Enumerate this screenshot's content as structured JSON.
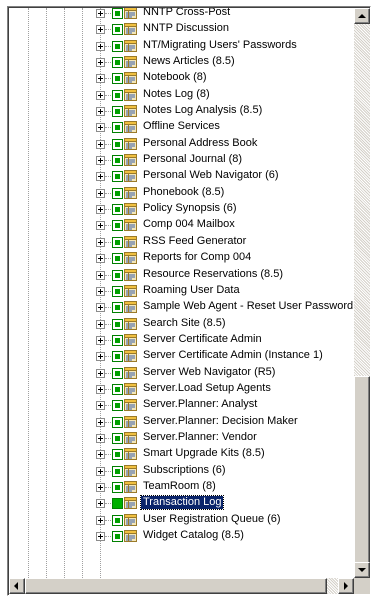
{
  "tree": {
    "selected_index": 28,
    "items": [
      {
        "label": "NNTP Cross-Post"
      },
      {
        "label": "NNTP Discussion"
      },
      {
        "label": "NT/Migrating Users' Passwords"
      },
      {
        "label": "News Articles (8.5)"
      },
      {
        "label": "Notebook (8)"
      },
      {
        "label": "Notes Log (8)"
      },
      {
        "label": "Notes Log Analysis (8.5)"
      },
      {
        "label": "Offline Services"
      },
      {
        "label": "Personal Address Book"
      },
      {
        "label": "Personal Journal (8)"
      },
      {
        "label": "Personal Web Navigator (6)"
      },
      {
        "label": "Phonebook (8.5)"
      },
      {
        "label": "Policy Synopsis (6)"
      },
      {
        "label": "Comp 004 Mailbox"
      },
      {
        "label": "RSS Feed Generator"
      },
      {
        "label": "Reports for Comp 004"
      },
      {
        "label": "Resource Reservations (8.5)"
      },
      {
        "label": "Roaming User Data"
      },
      {
        "label": "Sample Web Agent - Reset User Password"
      },
      {
        "label": "Search Site (8.5)"
      },
      {
        "label": "Server Certificate Admin"
      },
      {
        "label": "Server Certificate Admin (Instance 1)"
      },
      {
        "label": "Server Web Navigator (R5)"
      },
      {
        "label": "Server.Load Setup Agents"
      },
      {
        "label": "Server.Planner: Analyst"
      },
      {
        "label": "Server.Planner: Decision Maker"
      },
      {
        "label": "Server.Planner: Vendor"
      },
      {
        "label": "Smart Upgrade Kits (8.5)"
      },
      {
        "label": "Subscriptions (6)"
      },
      {
        "label": "TeamRoom (8)"
      },
      {
        "label": "Transaction Log"
      },
      {
        "label": "User Registration Queue (6)"
      },
      {
        "label": "Widget Catalog (8.5)"
      }
    ]
  },
  "scrollbar": {
    "vertical_position": 0.78,
    "horizontal_position": 0
  },
  "icons": {
    "expander": "plus-expander-icon",
    "checkbox": "partial-check-icon",
    "database": "database-template-icon"
  },
  "colors": {
    "selection": "#0a246a",
    "check_green": "#00a000"
  }
}
